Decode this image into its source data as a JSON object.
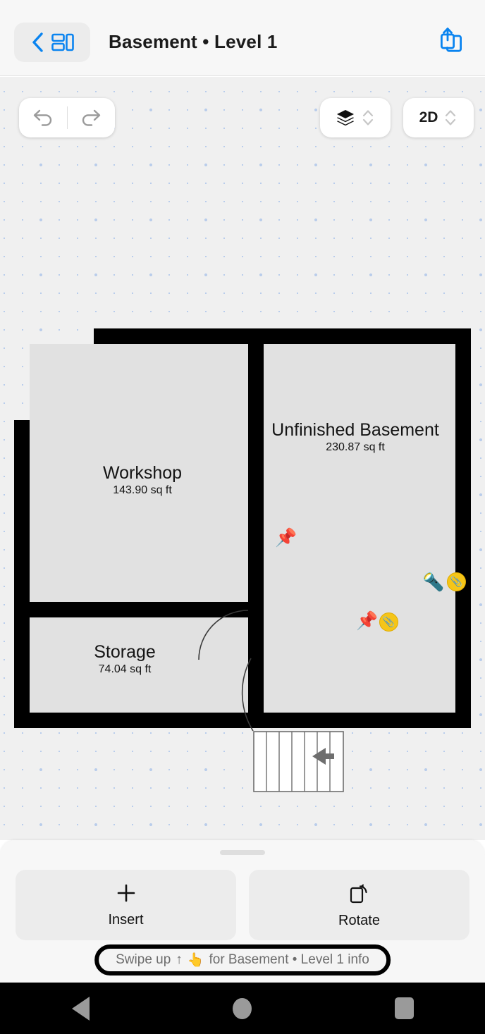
{
  "header": {
    "title": "Basement • Level 1",
    "back_icon": "chevron-left-icon",
    "grid_icon": "grid-layout-icon",
    "share_icon": "share-icon"
  },
  "canvas_toolbar": {
    "undo_label": "Undo",
    "redo_label": "Redo",
    "undo_enabled": false,
    "redo_enabled": false,
    "layers_label": "Layers",
    "dimension_label": "2D",
    "stepper_icon": "chevron-up-down-icon"
  },
  "floorplan": {
    "rooms": [
      {
        "name": "Unfinished Basement",
        "area": "230.87 sq ft"
      },
      {
        "name": "Workshop",
        "area": "143.90 sq ft"
      },
      {
        "name": "Storage",
        "area": "74.04 sq ft"
      }
    ],
    "markers": [
      {
        "icon": "pushpin-marker",
        "glyph": "📌",
        "badge": null
      },
      {
        "icon": "flashlight-marker",
        "glyph": "🔦",
        "badge": "📎"
      },
      {
        "icon": "pushpin-marker",
        "glyph": "📌",
        "badge": "📎"
      }
    ],
    "stairs": {
      "treads": 7,
      "direction_icon": "arrow-left-icon"
    },
    "doors": 2,
    "wall_color": "#000000",
    "room_fill_color": "#e1e1e1",
    "canvas_bg_color": "#f0f0f0",
    "grid_dot_color": "#b9cdec"
  },
  "bottom_sheet": {
    "grabber": "drag-handle",
    "actions": [
      {
        "label": "Insert",
        "icon": "plus-icon"
      },
      {
        "label": "Rotate",
        "icon": "rotate-icon"
      }
    ],
    "swipe_hint_prefix": "Swipe up",
    "swipe_hint_arrow": "↑",
    "swipe_hint_hand": "👆",
    "swipe_hint_suffix": "for Basement • Level 1 info"
  },
  "navbar": {
    "back": "back-button",
    "home": "home-button",
    "recents": "recents-button"
  },
  "colors": {
    "accent": "#0a84f0",
    "sheet_bg": "#f7f7f7",
    "button_bg": "#ececec"
  }
}
